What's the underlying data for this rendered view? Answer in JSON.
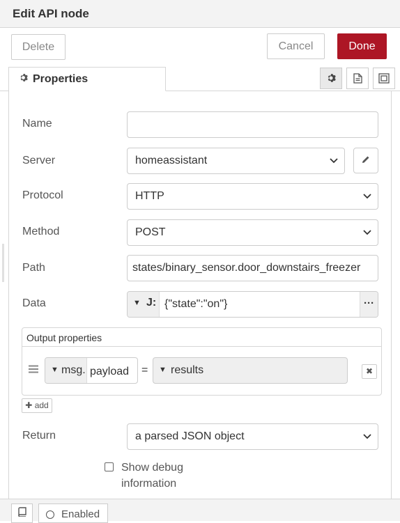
{
  "dialog": {
    "title": "Edit API node"
  },
  "toolbar": {
    "delete_label": "Delete",
    "cancel_label": "Cancel",
    "done_label": "Done"
  },
  "tabs": {
    "properties_label": "Properties",
    "icons": [
      "gear-icon",
      "document-icon",
      "appearance-icon"
    ]
  },
  "form": {
    "name": {
      "label": "Name",
      "value": "",
      "placeholder": ""
    },
    "server": {
      "label": "Server",
      "value": "homeassistant"
    },
    "protocol": {
      "label": "Protocol",
      "value": "HTTP"
    },
    "method": {
      "label": "Method",
      "value": "POST"
    },
    "path": {
      "label": "Path",
      "value": "states/binary_sensor.door_downstairs_freezer"
    },
    "data": {
      "label": "Data",
      "type_icon": "J:",
      "value": "{\"state\":\"on\"}"
    },
    "return": {
      "label": "Return",
      "value": "a parsed JSON object"
    },
    "debug": {
      "label": "Show debug information",
      "checked": false
    }
  },
  "output_properties": {
    "header": "Output properties",
    "rows": [
      {
        "prefix": "msg.",
        "property": "payload",
        "operator": "=",
        "value": "results"
      }
    ],
    "add_label": "add"
  },
  "footer": {
    "enabled_label": "Enabled"
  },
  "colors": {
    "done_button": "#ad1625",
    "border": "#d6d6d6",
    "header_bg": "#f3f3f3"
  }
}
